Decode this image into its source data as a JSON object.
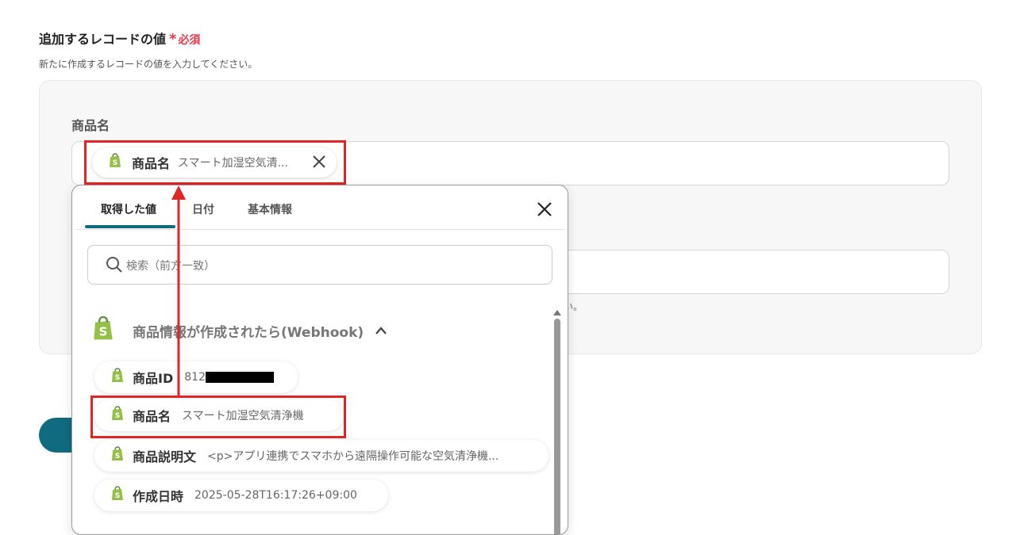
{
  "section": {
    "title": "追加するレコードの値",
    "required_star": "*",
    "required_label": "必須",
    "description": "新たに作成するレコードの値を入力してください。"
  },
  "field": {
    "label": "商品名",
    "chip": {
      "name": "商品名",
      "value": "スマート加湿空気清..."
    }
  },
  "background_hint": "い。",
  "dropdown": {
    "tabs": [
      {
        "label": "取得した値",
        "active": true
      },
      {
        "label": "日付",
        "active": false
      },
      {
        "label": "基本情報",
        "active": false
      }
    ],
    "search_placeholder": "検索（前方一致）",
    "group": {
      "title": "商品情報が作成されたら(Webhook)",
      "items": [
        {
          "name": "商品ID",
          "value": "812"
        },
        {
          "name": "商品名",
          "value": "スマート加湿空気清浄機"
        },
        {
          "name": "商品説明文",
          "value": "<p>アプリ連携でスマホから遠隔操作可能な空気清浄機..."
        },
        {
          "name": "作成日時",
          "value": "2025-05-28T16:17:26+09:00"
        }
      ]
    }
  },
  "colors": {
    "accent": "#106b80",
    "required": "#e23b4b",
    "highlight": "#e02525",
    "shopify_green": "#95bf47"
  },
  "icons": [
    "shopify-icon",
    "close-icon",
    "search-icon",
    "chevron-up-icon",
    "scroll-up-icon"
  ]
}
